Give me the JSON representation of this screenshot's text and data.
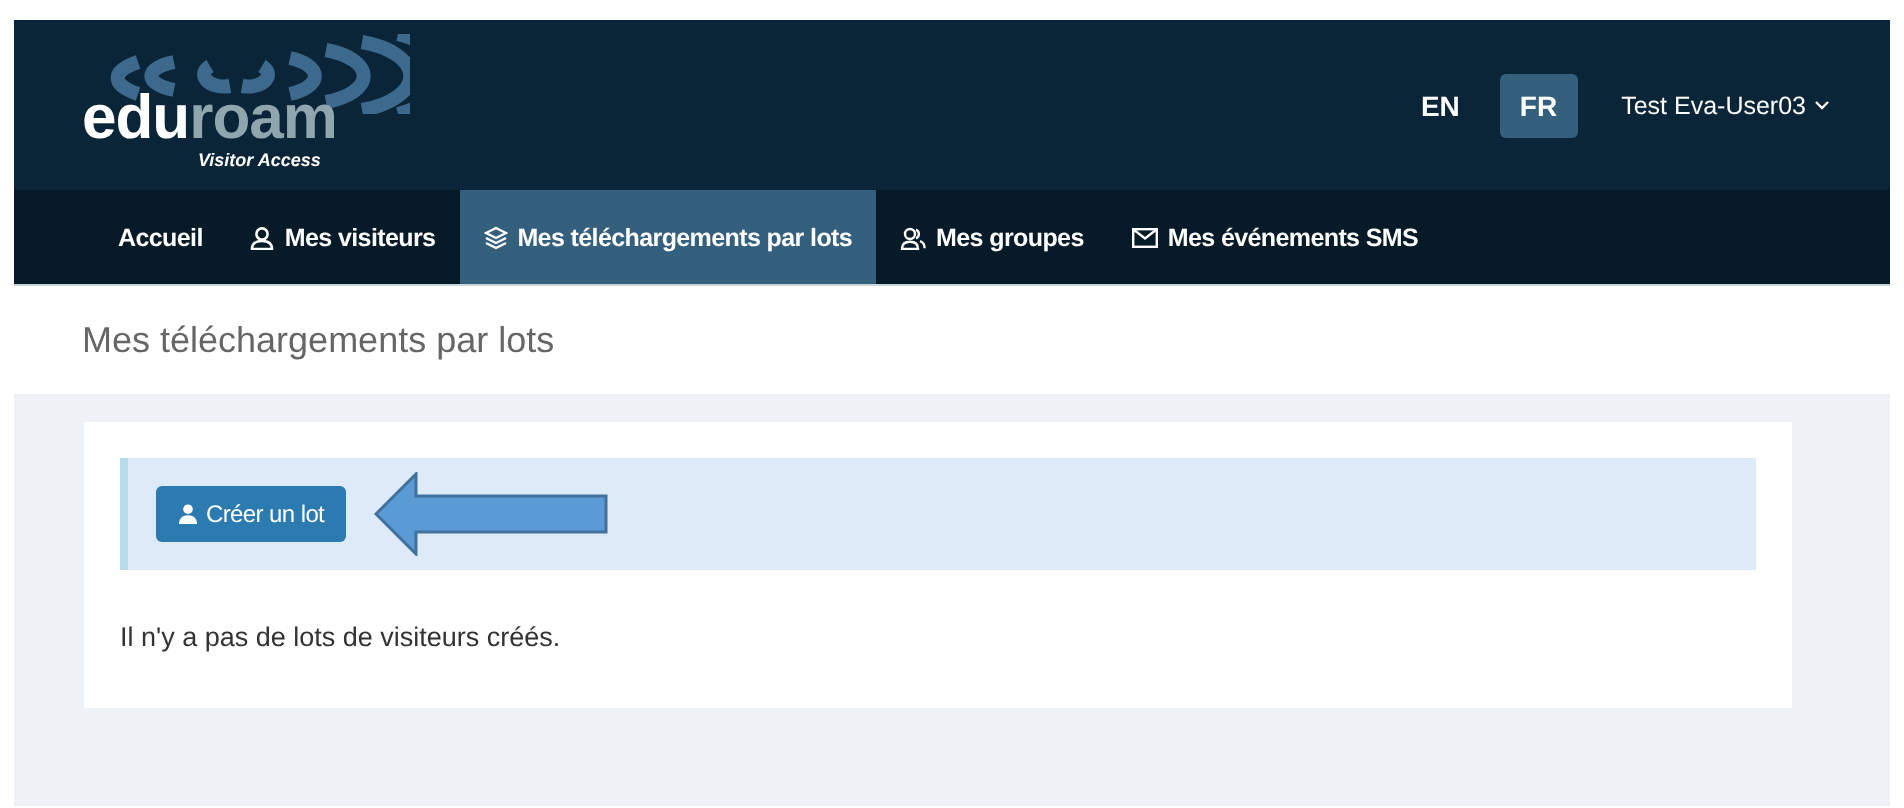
{
  "logo": {
    "wordmark_first": "edu",
    "wordmark_second": "roam",
    "tagline": "Visitor Access"
  },
  "languages": [
    {
      "label": "EN",
      "selected": false
    },
    {
      "label": "FR",
      "selected": true
    }
  ],
  "user_menu": {
    "label": "Test Eva-User03"
  },
  "nav": [
    {
      "label": "Accueil",
      "selected": false
    },
    {
      "label": "Mes visiteurs",
      "selected": false
    },
    {
      "label": "Mes téléchargements par lots",
      "selected": true
    },
    {
      "label": "Mes groupes",
      "selected": false
    },
    {
      "label": "Mes événements SMS",
      "selected": false
    }
  ],
  "page_title": "Mes téléchargements par lots",
  "create_button": {
    "label": "Créer un lot"
  },
  "empty_message": "Il n'y a pas de lots de visiteurs créés."
}
